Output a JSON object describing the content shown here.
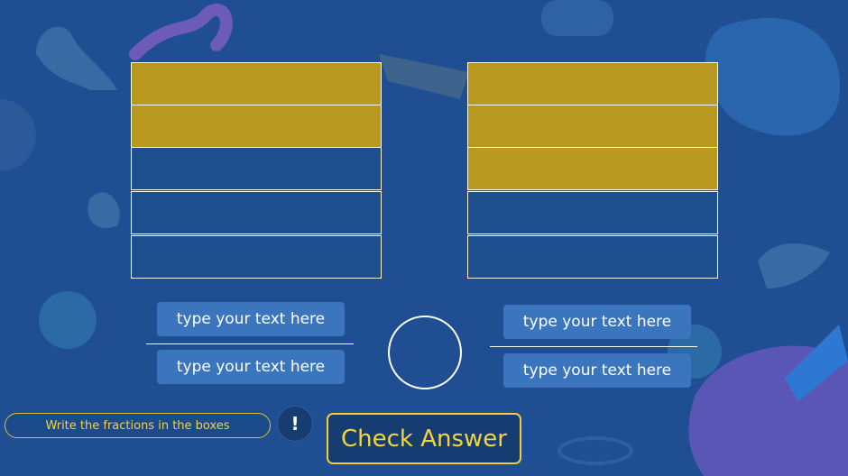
{
  "colors": {
    "background": "#1f4e93",
    "shaded": "#b8981e",
    "unshaded": "#1d4f8e",
    "input_box": "#3b75bd",
    "accent": "#f4d43e"
  },
  "models": [
    {
      "shaded": [
        true,
        true,
        false,
        false,
        false
      ],
      "numerator_placeholder": "type your text here",
      "denominator_placeholder": "type your text here"
    },
    {
      "shaded": [
        true,
        true,
        true,
        false,
        false
      ],
      "numerator_placeholder": "type your text here",
      "denominator_placeholder": "type your text here"
    }
  ],
  "instruction": "Write the fractions in the boxes",
  "hint_icon": "!",
  "check_button": "Check Answer"
}
